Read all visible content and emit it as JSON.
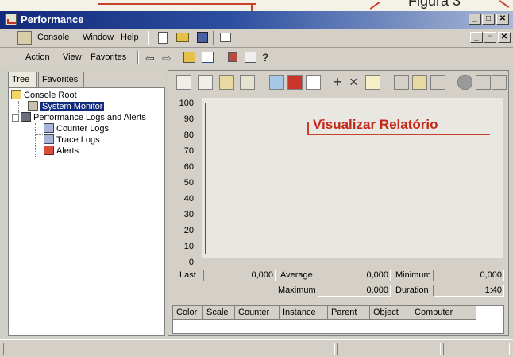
{
  "annotation": {
    "caption": "Figura 3",
    "color": "#c7402a"
  },
  "window": {
    "title": "Performance"
  },
  "menu": {
    "items": [
      "Console",
      "Window",
      "Help"
    ]
  },
  "action_menu": {
    "items": [
      "Action",
      "View",
      "Favorites"
    ]
  },
  "tree": {
    "tabs": [
      "Tree",
      "Favorites"
    ],
    "root": "Console Root",
    "system_monitor": "System Monitor",
    "logs": "Performance Logs and Alerts",
    "counter_logs": "Counter Logs",
    "trace_logs": "Trace Logs",
    "alerts": "Alerts"
  },
  "graph": {
    "y_ticks": [
      "100",
      "90",
      "80",
      "70",
      "60",
      "50",
      "40",
      "30",
      "20",
      "10",
      "0"
    ],
    "callout": "Visualizar Relatório"
  },
  "stats": {
    "last_label": "Last",
    "last_value": "0,000",
    "average_label": "Average",
    "average_value": "0,000",
    "minimum_label": "Minimum",
    "minimum_value": "0,000",
    "maximum_label": "Maximum",
    "maximum_value": "0,000",
    "duration_label": "Duration",
    "duration_value": "1:40"
  },
  "counters_table": {
    "columns": [
      "Color",
      "Scale",
      "Counter",
      "Instance",
      "Parent",
      "Object",
      "Computer"
    ]
  }
}
